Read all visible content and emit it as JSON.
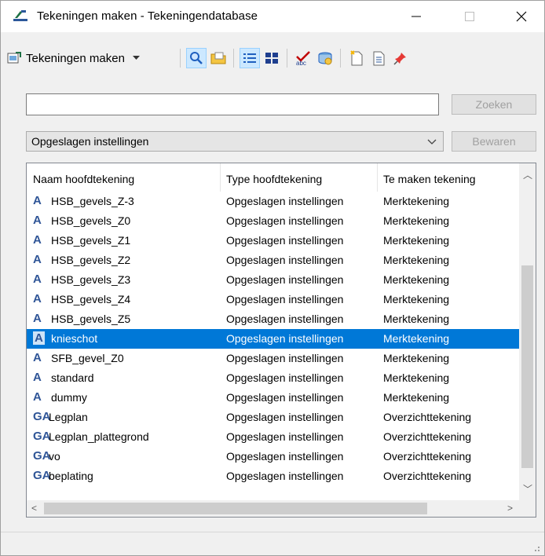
{
  "window": {
    "title": "Tekeningen maken - Tekeningendatabase",
    "icon": "drawing-app-icon",
    "controls": [
      "minimize-icon",
      "maximize-icon",
      "close-icon"
    ]
  },
  "toolbar": {
    "main_label": "Tekeningen maken",
    "buttons": [
      {
        "name": "search-tool-icon",
        "active": true
      },
      {
        "name": "folder-icon",
        "active": false
      },
      {
        "name": "details-view-icon",
        "active": true
      },
      {
        "name": "tiles-view-icon",
        "active": false
      },
      {
        "name": "spellcheck-icon",
        "active": false
      },
      {
        "name": "database-icon",
        "active": false
      },
      {
        "name": "new-drawing-icon",
        "active": false
      },
      {
        "name": "properties-icon",
        "active": false
      },
      {
        "name": "pin-icon",
        "active": false
      }
    ]
  },
  "search": {
    "value": "",
    "placeholder": "",
    "button_label": "Zoeken"
  },
  "settings": {
    "selected": "Opgeslagen instellingen",
    "save_label": "Bewaren"
  },
  "list": {
    "columns": [
      "Naam hoofdtekening",
      "Type hoofdtekening",
      "Te maken tekening"
    ],
    "rows": [
      {
        "icon": "A",
        "name": "HSB_gevels_Z-3",
        "type": "Opgeslagen instellingen",
        "drawing": "Merktekening"
      },
      {
        "icon": "A",
        "name": "HSB_gevels_Z0",
        "type": "Opgeslagen instellingen",
        "drawing": "Merktekening"
      },
      {
        "icon": "A",
        "name": "HSB_gevels_Z1",
        "type": "Opgeslagen instellingen",
        "drawing": "Merktekening"
      },
      {
        "icon": "A",
        "name": "HSB_gevels_Z2",
        "type": "Opgeslagen instellingen",
        "drawing": "Merktekening"
      },
      {
        "icon": "A",
        "name": "HSB_gevels_Z3",
        "type": "Opgeslagen instellingen",
        "drawing": "Merktekening"
      },
      {
        "icon": "A",
        "name": "HSB_gevels_Z4",
        "type": "Opgeslagen instellingen",
        "drawing": "Merktekening"
      },
      {
        "icon": "A",
        "name": "HSB_gevels_Z5",
        "type": "Opgeslagen instellingen",
        "drawing": "Merktekening"
      },
      {
        "icon": "A",
        "name": "knieschot",
        "type": "Opgeslagen instellingen",
        "drawing": "Merktekening",
        "selected": true
      },
      {
        "icon": "A",
        "name": "SFB_gevel_Z0",
        "type": "Opgeslagen instellingen",
        "drawing": "Merktekening"
      },
      {
        "icon": "A",
        "name": "standard",
        "type": "Opgeslagen instellingen",
        "drawing": "Merktekening"
      },
      {
        "icon": "A",
        "name": "dummy",
        "type": "Opgeslagen instellingen",
        "drawing": "Merktekening"
      },
      {
        "icon": "GA",
        "name": "Legplan",
        "type": "Opgeslagen instellingen",
        "drawing": "Overzichttekening"
      },
      {
        "icon": "GA",
        "name": "Legplan_plattegrond",
        "type": "Opgeslagen instellingen",
        "drawing": "Overzichttekening"
      },
      {
        "icon": "GA",
        "name": "vo",
        "type": "Opgeslagen instellingen",
        "drawing": "Overzichttekening"
      },
      {
        "icon": "GA",
        "name": "beplating",
        "type": "Opgeslagen instellingen",
        "drawing": "Overzichttekening"
      }
    ]
  },
  "colors": {
    "selection": "#0078d7",
    "icon_blue": "#2f5597"
  }
}
